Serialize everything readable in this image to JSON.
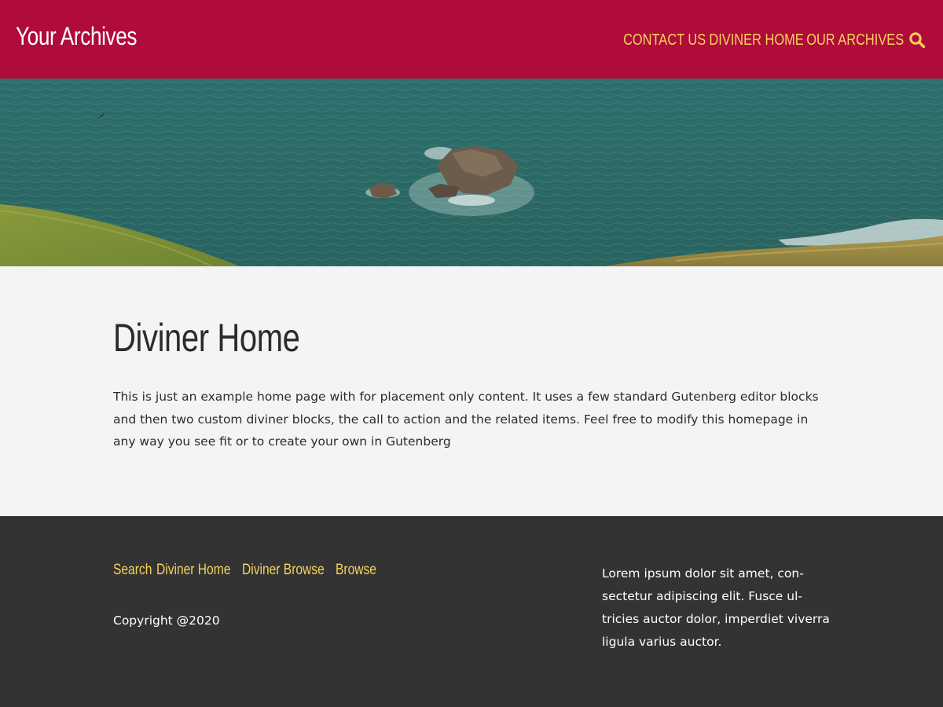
{
  "header": {
    "site_title": "Your Archives",
    "background_color": "#af0b3b",
    "nav_color": "#f6d35a",
    "nav": [
      {
        "label": "CONTACT US"
      },
      {
        "label": "DIVINER HOME"
      },
      {
        "label": "OUR ARCHIVES"
      }
    ],
    "search_icon": "search-icon"
  },
  "hero": {
    "image": "aerial photo of sea with rocks and grassy cliffs"
  },
  "main": {
    "title": "Diviner Home",
    "intro": "This is just an example home page with for placement only content. It uses a few standard Gutenberg editor blocks and then two custom diviner blocks, the call to action and the related items. Feel free to modify this homepage in any way you see fit or to create your own in Gutenberg"
  },
  "footer": {
    "background_color": "#333333",
    "links": [
      {
        "label": "Search"
      },
      {
        "label": "Diviner Home"
      },
      {
        "label": "Diviner Browse"
      },
      {
        "label": "Browse"
      }
    ],
    "copyright": "Copyright @2020",
    "text_lines": [
      "Lorem ipsum dolor sit amet, con-",
      "sectetur adipiscing elit. Fusce ul-",
      "tricies auctor dolor, imperdiet viverra",
      "ligula varius auctor."
    ]
  }
}
